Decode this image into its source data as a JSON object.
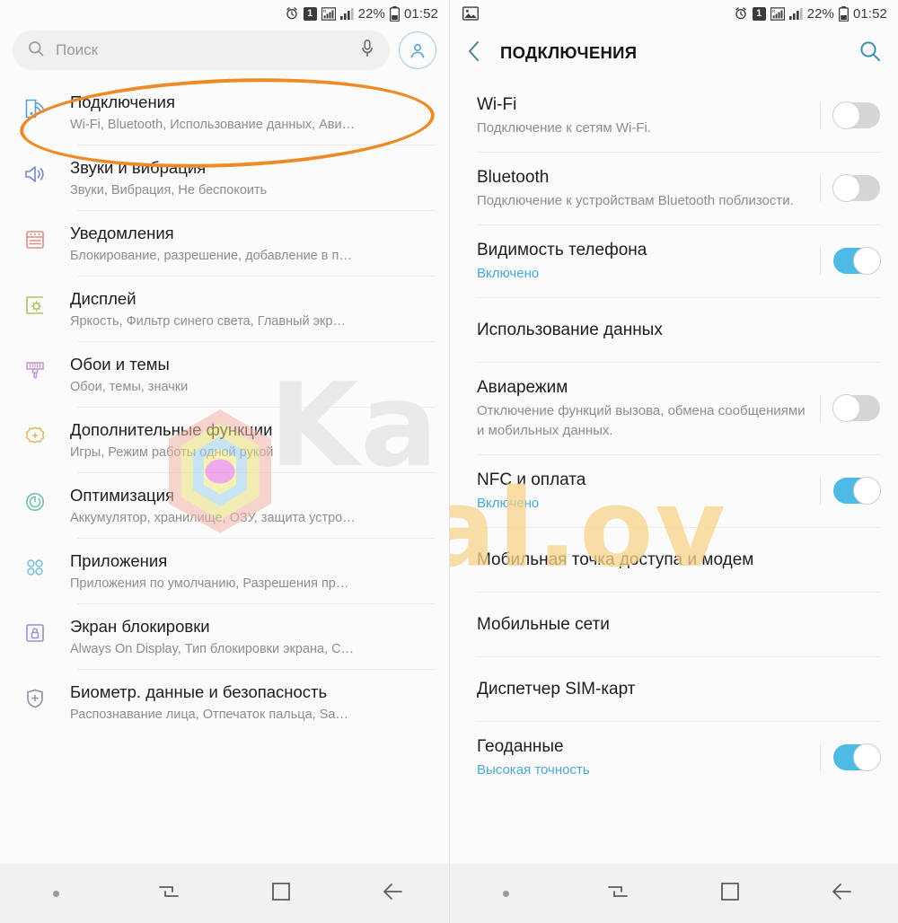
{
  "status_bar": {
    "alarm_icon": "alarm-clock-icon",
    "sim_badge": "1",
    "signal_roaming_icon": "signal-roaming-icon",
    "signal_icon": "signal-bars-icon",
    "battery_percent": "22%",
    "battery_icon": "battery-icon",
    "time": "01:52",
    "right_gallery_icon": "image-icon"
  },
  "left_panel": {
    "search": {
      "placeholder": "Поиск",
      "search_icon": "search-icon",
      "mic_icon": "microphone-icon"
    },
    "account_icon": "account-avatar-icon",
    "items": [
      {
        "title": "Подключения",
        "subtitle": "Wi-Fi, Bluetooth, Использование данных, Ави…",
        "icon": "connections-icon",
        "color": "#5ba3cf",
        "highlighted": true
      },
      {
        "title": "Звуки и вибрация",
        "subtitle": "Звуки, Вибрация, Не беспокоить",
        "icon": "sound-icon",
        "color": "#7a86c8"
      },
      {
        "title": "Уведомления",
        "subtitle": "Блокирование, разрешение, добавление в п…",
        "icon": "notifications-icon",
        "color": "#e08a8a"
      },
      {
        "title": "Дисплей",
        "subtitle": "Яркость, Фильтр синего света, Главный экр…",
        "icon": "display-icon",
        "color": "#a9c46a"
      },
      {
        "title": "Обои и темы",
        "subtitle": "Обои, темы, значки",
        "icon": "wallpaper-brush-icon",
        "color": "#c79ad4"
      },
      {
        "title": "Дополнительные функции",
        "subtitle": "Игры, Режим работы одной рукой",
        "icon": "advanced-features-icon",
        "color": "#dfb85e"
      },
      {
        "title": "Оптимизация",
        "subtitle": "Аккумулятор, хранилище, ОЗУ, защита устро…",
        "icon": "optimization-icon",
        "color": "#76c0b0"
      },
      {
        "title": "Приложения",
        "subtitle": "Приложения по умолчанию, Разрешения пр…",
        "icon": "apps-icon",
        "color": "#7ec2d8"
      },
      {
        "title": "Экран блокировки",
        "subtitle": "Always On Display, Тип блокировки экрана, C…",
        "icon": "lock-screen-icon",
        "color": "#9b8fd8"
      },
      {
        "title": "Биометр. данные и безопасность",
        "subtitle": "Распознавание лица, Отпечаток пальца, Sa…",
        "icon": "biometrics-shield-icon",
        "color": "#8d8da8"
      }
    ]
  },
  "right_panel": {
    "header": {
      "title": "ПОДКЛЮЧЕНИЯ",
      "back_icon": "back-chevron-icon",
      "search_icon": "search-icon"
    },
    "items": [
      {
        "title": "Wi-Fi",
        "subtitle": "Подключение к сетям Wi-Fi.",
        "subtitle_on": false,
        "toggle": "off"
      },
      {
        "title": "Bluetooth",
        "subtitle": "Подключение к устройствам Bluetooth поблизости.",
        "subtitle_on": false,
        "toggle": "off"
      },
      {
        "title": "Видимость телефона",
        "subtitle": "Включено",
        "subtitle_on": true,
        "toggle": "on"
      },
      {
        "title": "Использование данных",
        "subtitle": "",
        "subtitle_on": false,
        "toggle": "none"
      },
      {
        "title": "Авиарежим",
        "subtitle": "Отключение функций вызова, обмена сообщениями и мобильных данных.",
        "subtitle_on": false,
        "toggle": "off"
      },
      {
        "title": "NFC и оплата",
        "subtitle": "Включено",
        "subtitle_on": true,
        "toggle": "on"
      },
      {
        "title": "Мобильная точка доступа и модем",
        "subtitle": "",
        "subtitle_on": false,
        "toggle": "none"
      },
      {
        "title": "Мобильные сети",
        "subtitle": "",
        "subtitle_on": false,
        "toggle": "none",
        "highlighted": true
      },
      {
        "title": "Диспетчер SIM-карт",
        "subtitle": "",
        "subtitle_on": false,
        "toggle": "none"
      },
      {
        "title": "Геоданные",
        "subtitle": "Высокая точность",
        "subtitle_on": true,
        "toggle": "on"
      }
    ]
  },
  "nav_bar": {
    "items": [
      {
        "icon": "home-dot-icon"
      },
      {
        "icon": "recents-icon"
      },
      {
        "icon": "home-square-icon"
      },
      {
        "icon": "back-arrow-icon"
      }
    ]
  },
  "annotations": {
    "accent_color": "#ef8b26",
    "highlight_left": "Подключения",
    "highlight_right": "Мобильные сети"
  },
  "watermark": {
    "top_text": "Ka",
    "bottom_text": "anal.ov"
  }
}
